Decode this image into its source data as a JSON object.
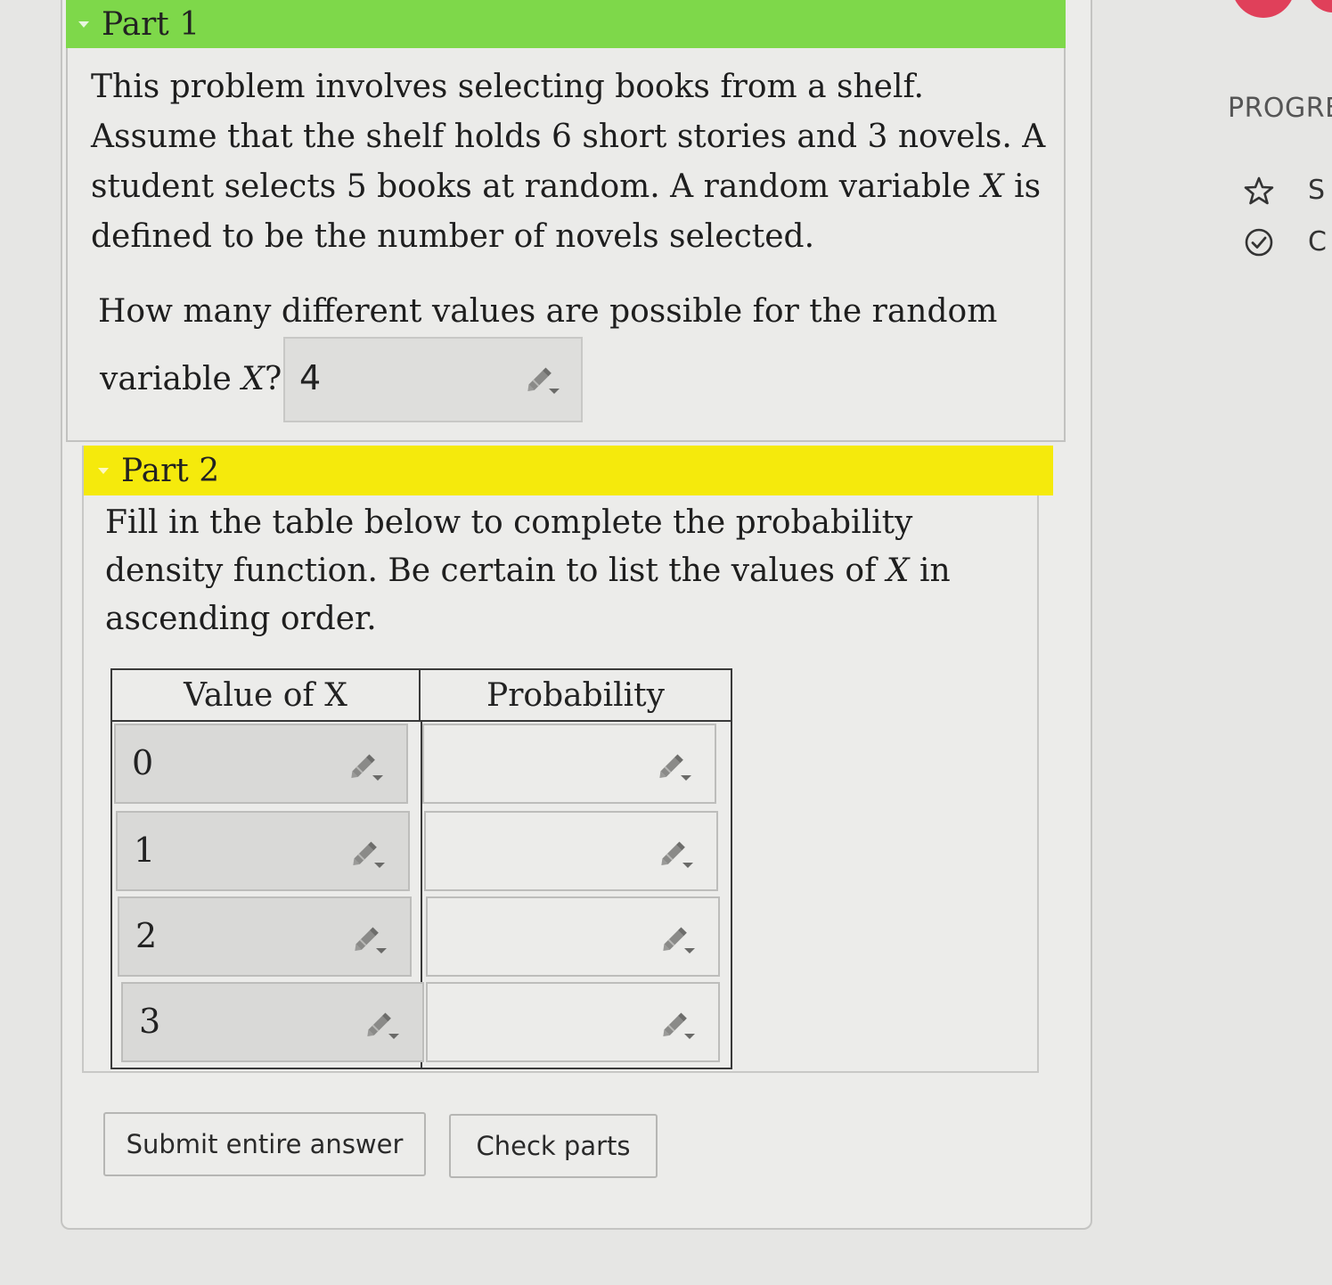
{
  "part1": {
    "title": "Part 1",
    "problem_text": "This problem involves selecting books from a shelf. Assume that the shelf holds 6 short stories and 3 novels. A student selects 5 books at random. A random variable X is defined to be the number of novels selected.",
    "question_line1": "How many different values are possible for the random",
    "question_line2": "variable X?",
    "answer_value": "4"
  },
  "part2": {
    "title": "Part 2",
    "instructions": "Fill in the table below to complete the probability density function. Be certain to list the values of X in ascending order.",
    "table": {
      "headers": [
        "Value of X",
        "Probability"
      ],
      "rows": [
        {
          "x": "0",
          "p": ""
        },
        {
          "x": "1",
          "p": ""
        },
        {
          "x": "2",
          "p": ""
        },
        {
          "x": "3",
          "p": ""
        }
      ]
    }
  },
  "buttons": {
    "submit": "Submit entire answer",
    "check": "Check parts"
  },
  "sidebar": {
    "title": "PROGRE",
    "items": [
      {
        "label": "S",
        "icon": "star-icon"
      },
      {
        "label": "C",
        "icon": "check-circle-icon"
      }
    ]
  },
  "colors": {
    "part1_header": "#7ed84a",
    "part2_header": "#f5ea0c"
  }
}
